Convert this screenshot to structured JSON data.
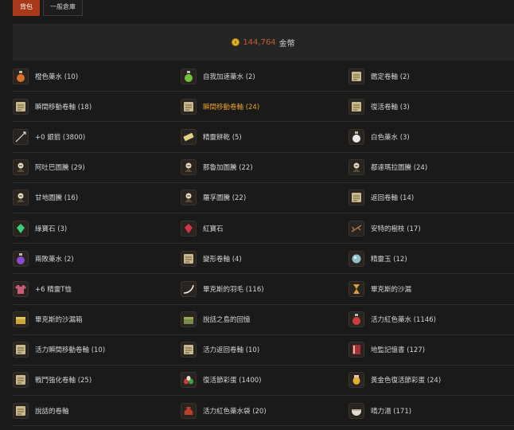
{
  "tabs": [
    "背包",
    "一般倉庫"
  ],
  "gold": {
    "amount": "144,764",
    "unit": "金幣"
  },
  "items": [
    [
      {
        "label": "橙色藥水 (10)",
        "icon": "orange-potion-icon"
      },
      {
        "label": "自我加速藥水 (2)",
        "icon": "green-potion-icon"
      },
      {
        "label": "鑑定卷軸 (2)",
        "icon": "scroll-icon"
      }
    ],
    [
      {
        "label": "瞬間移動卷軸 (18)",
        "icon": "scroll-icon"
      },
      {
        "label": "瞬間移動卷軸 (24)",
        "icon": "scroll-icon",
        "highlight": true
      },
      {
        "label": "復活卷軸 (3)",
        "icon": "scroll-icon"
      }
    ],
    [
      {
        "label": "+0 銀箭 (3800)",
        "icon": "arrow-icon"
      },
      {
        "label": "精靈餅乾 (5)",
        "icon": "biscuit-icon"
      },
      {
        "label": "白色藥水 (3)",
        "icon": "white-potion-icon"
      }
    ],
    [
      {
        "label": "阿吐巴圖騰 (29)",
        "icon": "totem-icon"
      },
      {
        "label": "那魯加圖騰 (22)",
        "icon": "totem-icon"
      },
      {
        "label": "都達瑪拉圖騰 (24)",
        "icon": "totem-icon"
      }
    ],
    [
      {
        "label": "甘地圖騰 (16)",
        "icon": "totem-icon"
      },
      {
        "label": "羅孚圖騰 (22)",
        "icon": "totem-icon"
      },
      {
        "label": "返回卷軸 (14)",
        "icon": "scroll-icon"
      }
    ],
    [
      {
        "label": "綠寶石 (3)",
        "icon": "emerald-icon"
      },
      {
        "label": "紅寶石",
        "icon": "ruby-icon"
      },
      {
        "label": "安特的樹枝 (17)",
        "icon": "branch-icon"
      }
    ],
    [
      {
        "label": "兩敗藥水 (2)",
        "icon": "purple-potion-icon"
      },
      {
        "label": "變形卷軸 (4)",
        "icon": "scroll-icon"
      },
      {
        "label": "精靈玉 (12)",
        "icon": "orb-icon"
      }
    ],
    [
      {
        "label": "+6 精靈T恤",
        "icon": "tshirt-icon"
      },
      {
        "label": "畢克斯的羽毛 (116)",
        "icon": "feather-icon"
      },
      {
        "label": "畢克斯的沙漏",
        "icon": "hourglass-icon"
      }
    ],
    [
      {
        "label": "畢克斯的沙漏箱",
        "icon": "chest-icon"
      },
      {
        "label": "說話之島的回憶",
        "icon": "chest-green-icon"
      },
      {
        "label": "活力紅色藥水 (1146)",
        "icon": "red-potion-icon"
      }
    ],
    [
      {
        "label": "活力瞬間移動卷軸 (10)",
        "icon": "scroll-icon"
      },
      {
        "label": "活力返回卷軸 (10)",
        "icon": "scroll-icon"
      },
      {
        "label": "地監記憶書 (127)",
        "icon": "book-icon"
      }
    ],
    [
      {
        "label": "戰鬥強化卷軸 (25)",
        "icon": "scroll-icon"
      },
      {
        "label": "復活節彩蛋 (1400)",
        "icon": "eggs-icon"
      },
      {
        "label": "黃金色復活節彩蛋 (24)",
        "icon": "gold-egg-icon"
      }
    ],
    [
      {
        "label": "說話的卷軸",
        "icon": "scroll-icon"
      },
      {
        "label": "活力紅色藥水袋 (20)",
        "icon": "pouch-icon"
      },
      {
        "label": "晴力湯 (171)",
        "icon": "soup-icon"
      }
    ]
  ],
  "colors": {
    "accent": "#a8381a",
    "highlight": "#e6a128",
    "gold_text": "#c35a2c"
  }
}
